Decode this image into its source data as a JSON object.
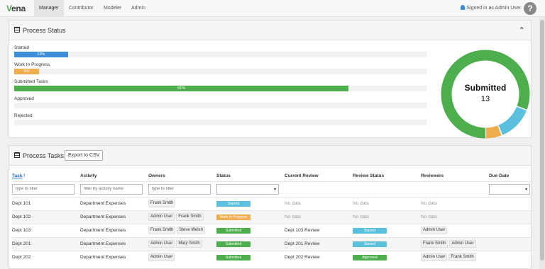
{
  "nav": {
    "logo_letter": "V",
    "logo_rest": "ena",
    "tabs": [
      "Manager",
      "Contributor",
      "Modeler",
      "Admin"
    ],
    "signed_in": "Signed in as Admin User",
    "help": "?"
  },
  "status_panel": {
    "title": "Process Status",
    "collapse": "⌃",
    "bars": [
      {
        "label": "Started",
        "percent_text": "13%",
        "value": 13,
        "color": "#3d8ed8"
      },
      {
        "label": "Work In Progress",
        "percent_text": "6%",
        "value": 6,
        "color": "#f0ad4e"
      },
      {
        "label": "Submitted Tasks",
        "percent_text": "81%",
        "value": 81,
        "color": "#4cae4c"
      },
      {
        "label": "Approved",
        "percent_text": "",
        "value": 0,
        "color": "#4cae4c"
      },
      {
        "label": "Rejected",
        "percent_text": "",
        "value": 0,
        "color": "#d9534f"
      }
    ],
    "donut": {
      "title": "Submitted",
      "count": "13",
      "segments": [
        {
          "name": "Submitted",
          "value": 81,
          "color": "#4cae4c"
        },
        {
          "name": "Started",
          "value": 13,
          "color": "#5bc0de"
        },
        {
          "name": "Work In Progress",
          "value": 6,
          "color": "#f0ad4e"
        }
      ]
    }
  },
  "tasks_panel": {
    "title": "Process Tasks",
    "export_label": "Export to CSV",
    "columns": [
      "Task",
      "Activity",
      "Owners",
      "Status",
      "Current Review",
      "Review Status",
      "Reviewers",
      "Due Date"
    ],
    "sort_indicator": "!",
    "filters": {
      "task_placeholder": "type to filter",
      "activity_placeholder": "filter by activity name",
      "owners_placeholder": "type to filter",
      "select_caret": "▾"
    },
    "rows": [
      {
        "task": "Dept 101",
        "activity": "Department Expenses",
        "owners": [
          "Frank Smith"
        ],
        "status": "Started",
        "status_color": "#5bc0de",
        "current_review": "No data",
        "review_status": "No data",
        "review_status_color": "",
        "reviewers": [],
        "reviewers_text": "No data"
      },
      {
        "task": "Dept 102",
        "activity": "Department Expenses",
        "owners": [
          "Admin User",
          "Frank Smith"
        ],
        "status": "Work In Progress",
        "status_color": "#f0ad4e",
        "current_review": "No data",
        "review_status": "No data",
        "review_status_color": "",
        "reviewers": [],
        "reviewers_text": "No data"
      },
      {
        "task": "Dept 103",
        "activity": "Department Expenses",
        "owners": [
          "Frank Smith",
          "Steve Welsh"
        ],
        "status": "Submitted",
        "status_color": "#4cae4c",
        "current_review": "Dept 103 Review",
        "review_status": "Started",
        "review_status_color": "#5bc0de",
        "reviewers": [
          "Admin User"
        ],
        "reviewers_text": ""
      },
      {
        "task": "Dept 201",
        "activity": "Department Expenses",
        "owners": [
          "Admin User",
          "Mary Smith"
        ],
        "status": "Submitted",
        "status_color": "#4cae4c",
        "current_review": "Dept 201 Review",
        "review_status": "Started",
        "review_status_color": "#5bc0de",
        "reviewers": [
          "Frank Smith",
          "Admin User"
        ],
        "reviewers_text": ""
      },
      {
        "task": "Dept 202",
        "activity": "Department Expenses",
        "owners": [
          "Admin User"
        ],
        "status": "Submitted",
        "status_color": "#4cae4c",
        "current_review": "Dept 202 Review",
        "review_status": "Approved",
        "review_status_color": "#4cae4c",
        "reviewers": [
          "Admin User",
          "Frank Smith"
        ],
        "reviewers_text": ""
      }
    ]
  }
}
